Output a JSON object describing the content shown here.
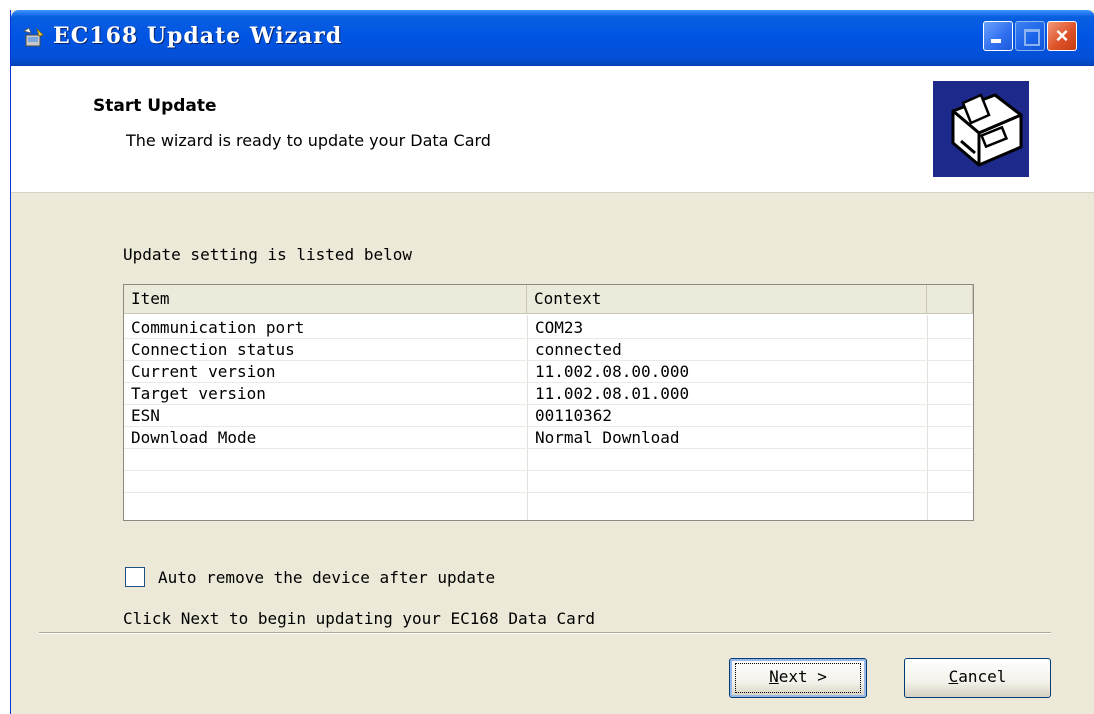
{
  "window": {
    "title": "EC168 Update Wizard",
    "title_icon": "wizard-app-icon",
    "controls": {
      "minimize": "minimize-icon",
      "maximize": "maximize-icon",
      "close": "close-icon"
    }
  },
  "header": {
    "title": "Start Update",
    "subtitle": "The wizard is ready to update your Data Card",
    "logo_icon": "datacard-box-icon"
  },
  "body": {
    "section_label": "Update setting is listed below",
    "table": {
      "columns": [
        "Item",
        "Context",
        ""
      ],
      "rows": [
        [
          "Communication port",
          "COM23"
        ],
        [
          "Connection status",
          "connected"
        ],
        [
          "Current version",
          "11.002.08.00.000"
        ],
        [
          "Target version",
          "11.002.08.01.000"
        ],
        [
          "ESN",
          "00110362"
        ],
        [
          "Download Mode",
          "Normal Download"
        ],
        [
          "",
          ""
        ],
        [
          "",
          ""
        ]
      ]
    },
    "auto_remove": {
      "label": "Auto remove the device after update",
      "checked": false
    },
    "next_hint": "Click Next to begin updating your EC168 Data Card"
  },
  "buttons": {
    "next": {
      "mnemonic": "N",
      "rest": "ext >"
    },
    "cancel": {
      "mnemonic": "C",
      "rest": "ancel"
    }
  },
  "colors": {
    "titlebar": "#0054e3",
    "dialog_bg": "#ece9d8",
    "header_bg": "#ffffff",
    "logo_bg": "#1d2a8c"
  }
}
